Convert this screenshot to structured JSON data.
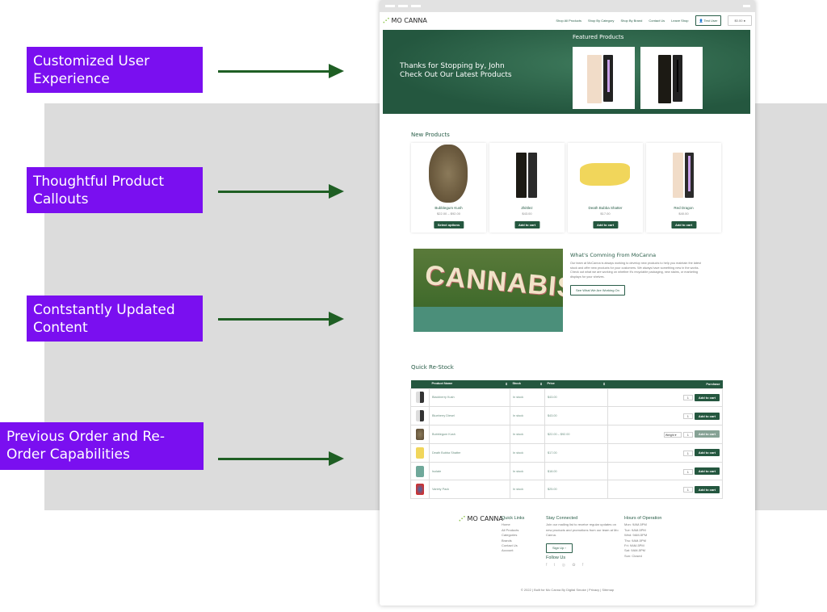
{
  "callouts": [
    "Customized User Experience",
    "Thoughtful Product Callouts",
    "Contstantly Updated Content",
    "Previous Order and Re-Order Capabilities"
  ],
  "colors": {
    "purple": "#7a0ff0",
    "arrow": "#1f5f24",
    "brand_green": "#24573f"
  },
  "site": {
    "logo": "MO CANNA",
    "nav": [
      "Shop All Products",
      "Shop By Category",
      "Shop By Brand",
      "Contact Us",
      "Leave Shop"
    ],
    "user_button": "Test User",
    "cart_button": "$0.00",
    "hero": {
      "line1": "Thanks for Stopping by, John",
      "line2": "Check Out Our Latest Products",
      "featured_title": "Featured Products"
    },
    "new_products": {
      "title": "New Products",
      "items": [
        {
          "name": "Bubblegum Kush",
          "price": "$22.00 – $92.00",
          "button": "Select options"
        },
        {
          "name": "Zkittlez",
          "price": "$43.00",
          "button": "Add to cart"
        },
        {
          "name": "Death Bubba Shatter",
          "price": "$17.00",
          "button": "Add to cart"
        },
        {
          "name": "Red Dragon",
          "price": "$40.00",
          "button": "Add to cart"
        }
      ]
    },
    "coming": {
      "image_text": "CANNABIS",
      "title": "What's Comming From MoCanna",
      "body": "Our team at MoCanna is always working to develop new products to help you maintain the latest stock and offer new products for your customers. We always have something new in the works. Check out what we are working on whether it's recyclable packaging, new stains, or marketing displays for your shelves.",
      "button": "See What We Are Working On"
    },
    "restock": {
      "title": "Quick Re-Stock",
      "columns": [
        "Product Name",
        "Stock",
        "Price",
        "Purchase"
      ],
      "rows": [
        {
          "name": "Blackberry Kush",
          "stock": "In stock",
          "price": "$43.00",
          "qty": "1",
          "button": "Add to cart"
        },
        {
          "name": "Blueberry Diesel",
          "stock": "In stock",
          "price": "$43.00",
          "qty": "1",
          "button": "Add to cart"
        },
        {
          "name": "Bubblegum Kush",
          "stock": "In stock",
          "price": "$22.00 – $92.00",
          "qty": "1",
          "select": "Weight",
          "button": "Add to cart"
        },
        {
          "name": "Death Bubba Shatter",
          "stock": "In stock",
          "price": "$17.00",
          "qty": "1",
          "button": "Add to cart"
        },
        {
          "name": "Isolate",
          "stock": "In stock",
          "price": "$18.00",
          "qty": "1",
          "button": "Add to cart"
        },
        {
          "name": "Variety Pack",
          "stock": "In stock",
          "price": "$25.00",
          "qty": "1",
          "button": "Add to cart"
        }
      ]
    },
    "footer": {
      "quick_links_title": "Quick Links",
      "quick_links": [
        "Home",
        "All Products",
        "Categories",
        "Brands",
        "Contact Us",
        "Account"
      ],
      "stay_title": "Stay Connected",
      "stay_text": "Join our mailing list to receive regular updates on new products and promotions from our team at Mo Canna.",
      "signup": "Sign Up ›",
      "follow_title": "Follow Us",
      "social_icons": [
        "facebook-icon",
        "twitter-icon",
        "instagram-icon",
        "yelp-icon",
        "facebook-icon"
      ],
      "hours_title": "Hours of Operation",
      "hours": [
        "Mon: 9AM-5PM",
        "Tue: 9AM-5PM",
        "Wed: 9AM-5PM",
        "Thu: 9AM-5PM",
        "Fri: 9AM-5PM",
        "Sat: 9AM-5PM",
        "Sun: Closed"
      ],
      "copyright": "© 2022 | Built for Mo Canna By Digital Smoke | Privacy | Sitemap"
    }
  }
}
